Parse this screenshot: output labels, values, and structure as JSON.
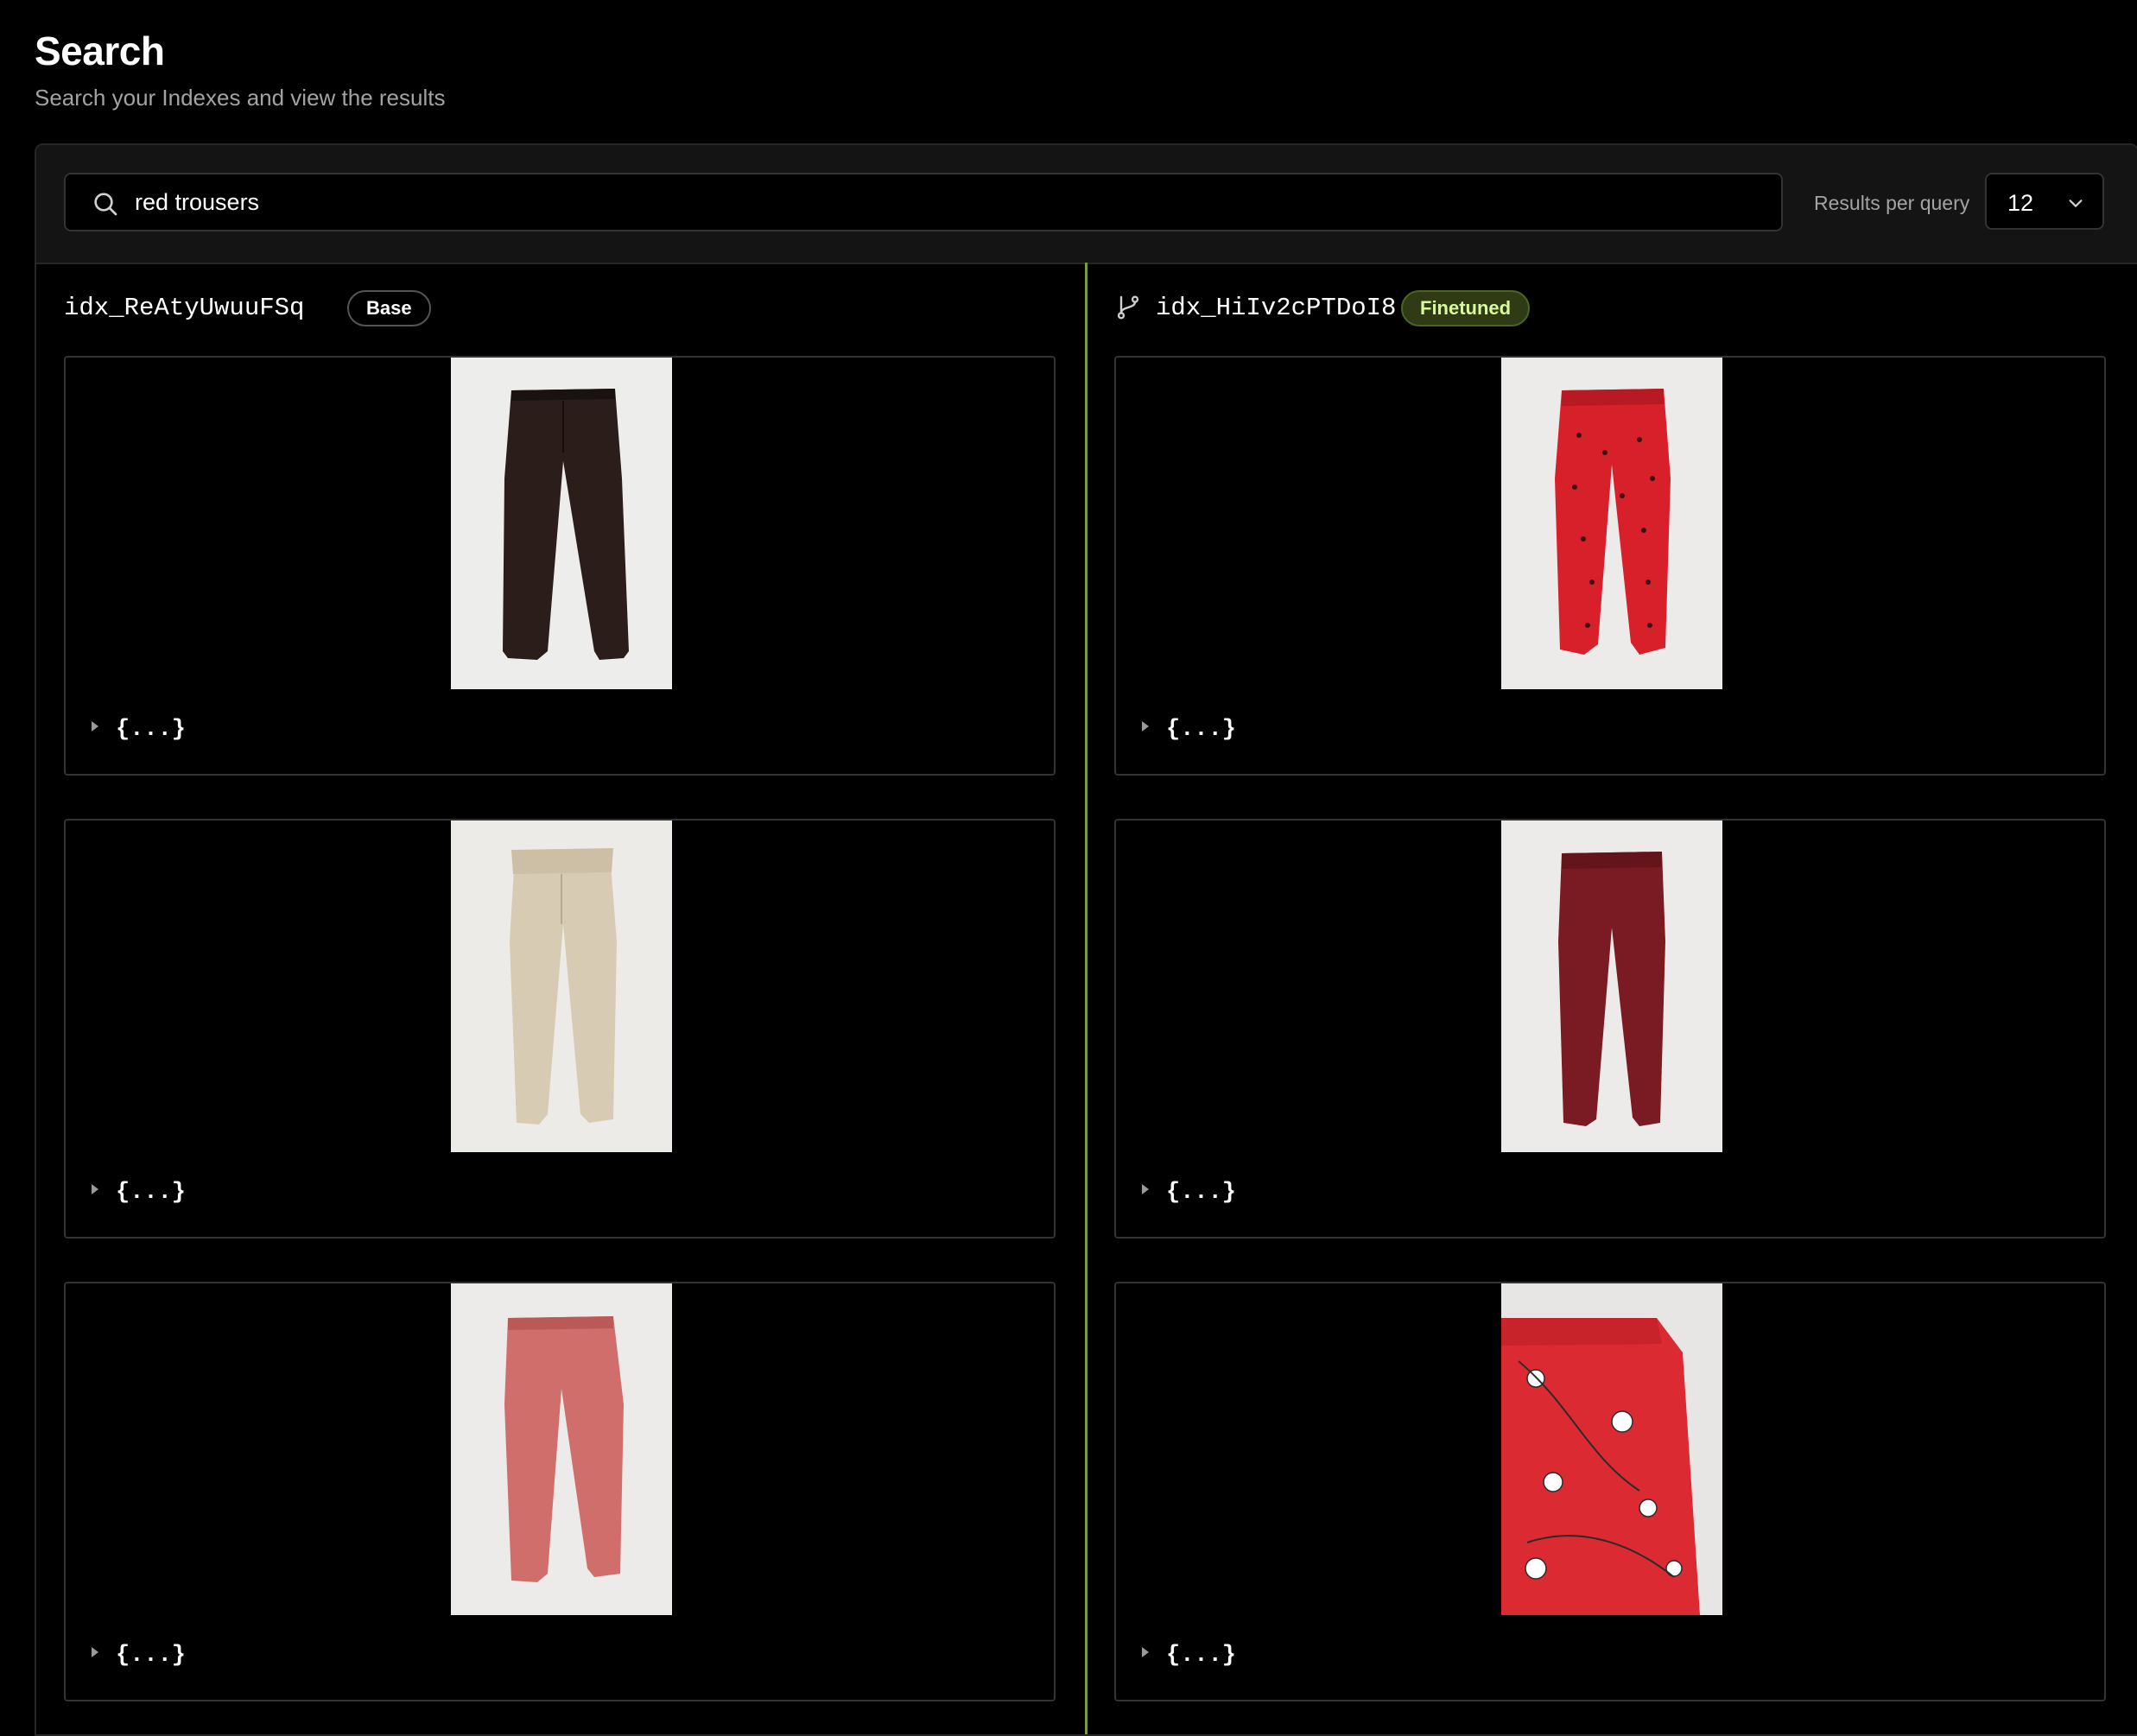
{
  "header": {
    "title": "Search",
    "subtitle": "Search your Indexes and view the results"
  },
  "search": {
    "query": "red trousers",
    "icon": "search-icon"
  },
  "results_per_query": {
    "label": "Results per query",
    "value": "12"
  },
  "columns": [
    {
      "index_name": "idx_ReAtyUwuuFSq",
      "badge": "Base",
      "results": [
        {
          "metadata": "{...}",
          "image": "dark brown trousers"
        },
        {
          "metadata": "{...}",
          "image": "beige paperbag trousers"
        },
        {
          "metadata": "{...}",
          "image": "dusty pink chinos"
        }
      ]
    },
    {
      "index_name": "idx_HiIv2cPTDoI8",
      "badge": "Finetuned",
      "icon": "branch-icon",
      "results": [
        {
          "metadata": "{...}",
          "image": "red patterned trousers"
        },
        {
          "metadata": "{...}",
          "image": "burgundy trousers"
        },
        {
          "metadata": "{...}",
          "image": "red floral trousers"
        }
      ]
    }
  ],
  "colors": {
    "background": "#000000",
    "accent_divider": "#7a9a4a",
    "finetuned_badge_text": "#d9f99d"
  }
}
